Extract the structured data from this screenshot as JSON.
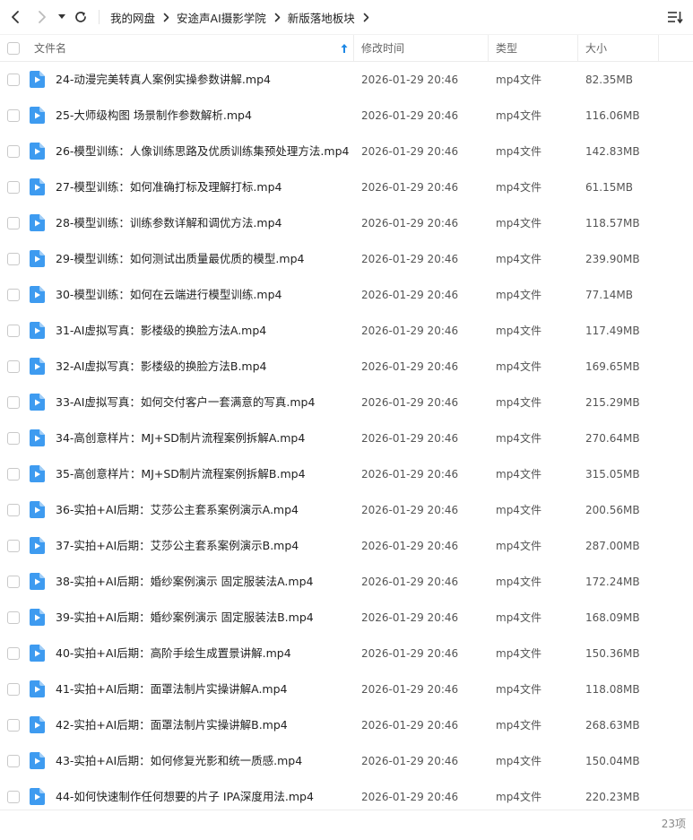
{
  "toolbar": {
    "breadcrumbs": [
      "我的网盘",
      "安途声AI摄影学院",
      "新版落地板块"
    ]
  },
  "header": {
    "name": "文件名",
    "date": "修改时间",
    "type": "类型",
    "size": "大小"
  },
  "colors": {
    "accent": "#1e88e5",
    "file_icon": "#3e9bf0"
  },
  "files": [
    {
      "name": "24-动漫完美转真人案例实操参数讲解.mp4",
      "date": "2026-01-29 20:46",
      "type": "mp4文件",
      "size": "82.35MB"
    },
    {
      "name": "25-大师级构图 场景制作参数解析.mp4",
      "date": "2026-01-29 20:46",
      "type": "mp4文件",
      "size": "116.06MB"
    },
    {
      "name": "26-模型训练：人像训练思路及优质训练集预处理方法.mp4",
      "date": "2026-01-29 20:46",
      "type": "mp4文件",
      "size": "142.83MB"
    },
    {
      "name": "27-模型训练：如何准确打标及理解打标.mp4",
      "date": "2026-01-29 20:46",
      "type": "mp4文件",
      "size": "61.15MB"
    },
    {
      "name": "28-模型训练：训练参数详解和调优方法.mp4",
      "date": "2026-01-29 20:46",
      "type": "mp4文件",
      "size": "118.57MB"
    },
    {
      "name": "29-模型训练：如何测试出质量最优质的模型.mp4",
      "date": "2026-01-29 20:46",
      "type": "mp4文件",
      "size": "239.90MB"
    },
    {
      "name": "30-模型训练：如何在云端进行模型训练.mp4",
      "date": "2026-01-29 20:46",
      "type": "mp4文件",
      "size": "77.14MB"
    },
    {
      "name": "31-AI虚拟写真：影楼级的换脸方法A.mp4",
      "date": "2026-01-29 20:46",
      "type": "mp4文件",
      "size": "117.49MB"
    },
    {
      "name": "32-AI虚拟写真：影楼级的换脸方法B.mp4",
      "date": "2026-01-29 20:46",
      "type": "mp4文件",
      "size": "169.65MB"
    },
    {
      "name": "33-AI虚拟写真：如何交付客户一套满意的写真.mp4",
      "date": "2026-01-29 20:46",
      "type": "mp4文件",
      "size": "215.29MB"
    },
    {
      "name": "34-高创意样片：MJ+SD制片流程案例拆解A.mp4",
      "date": "2026-01-29 20:46",
      "type": "mp4文件",
      "size": "270.64MB"
    },
    {
      "name": "35-高创意样片：MJ+SD制片流程案例拆解B.mp4",
      "date": "2026-01-29 20:46",
      "type": "mp4文件",
      "size": "315.05MB"
    },
    {
      "name": "36-实拍+AI后期：艾莎公主套系案例演示A.mp4",
      "date": "2026-01-29 20:46",
      "type": "mp4文件",
      "size": "200.56MB"
    },
    {
      "name": "37-实拍+AI后期：艾莎公主套系案例演示B.mp4",
      "date": "2026-01-29 20:46",
      "type": "mp4文件",
      "size": "287.00MB"
    },
    {
      "name": "38-实拍+AI后期：婚纱案例演示 固定服装法A.mp4",
      "date": "2026-01-29 20:46",
      "type": "mp4文件",
      "size": "172.24MB"
    },
    {
      "name": "39-实拍+AI后期：婚纱案例演示 固定服装法B.mp4",
      "date": "2026-01-29 20:46",
      "type": "mp4文件",
      "size": "168.09MB"
    },
    {
      "name": "40-实拍+AI后期：高阶手绘生成置景讲解.mp4",
      "date": "2026-01-29 20:46",
      "type": "mp4文件",
      "size": "150.36MB"
    },
    {
      "name": "41-实拍+AI后期：面罩法制片实操讲解A.mp4",
      "date": "2026-01-29 20:46",
      "type": "mp4文件",
      "size": "118.08MB"
    },
    {
      "name": "42-实拍+AI后期：面罩法制片实操讲解B.mp4",
      "date": "2026-01-29 20:46",
      "type": "mp4文件",
      "size": "268.63MB"
    },
    {
      "name": "43-实拍+AI后期：如何修复光影和统一质感.mp4",
      "date": "2026-01-29 20:46",
      "type": "mp4文件",
      "size": "150.04MB"
    },
    {
      "name": "44-如何快速制作任何想要的片子 IPA深度用法.mp4",
      "date": "2026-01-29 20:46",
      "type": "mp4文件",
      "size": "220.23MB"
    }
  ],
  "footer": {
    "count": "23项"
  }
}
